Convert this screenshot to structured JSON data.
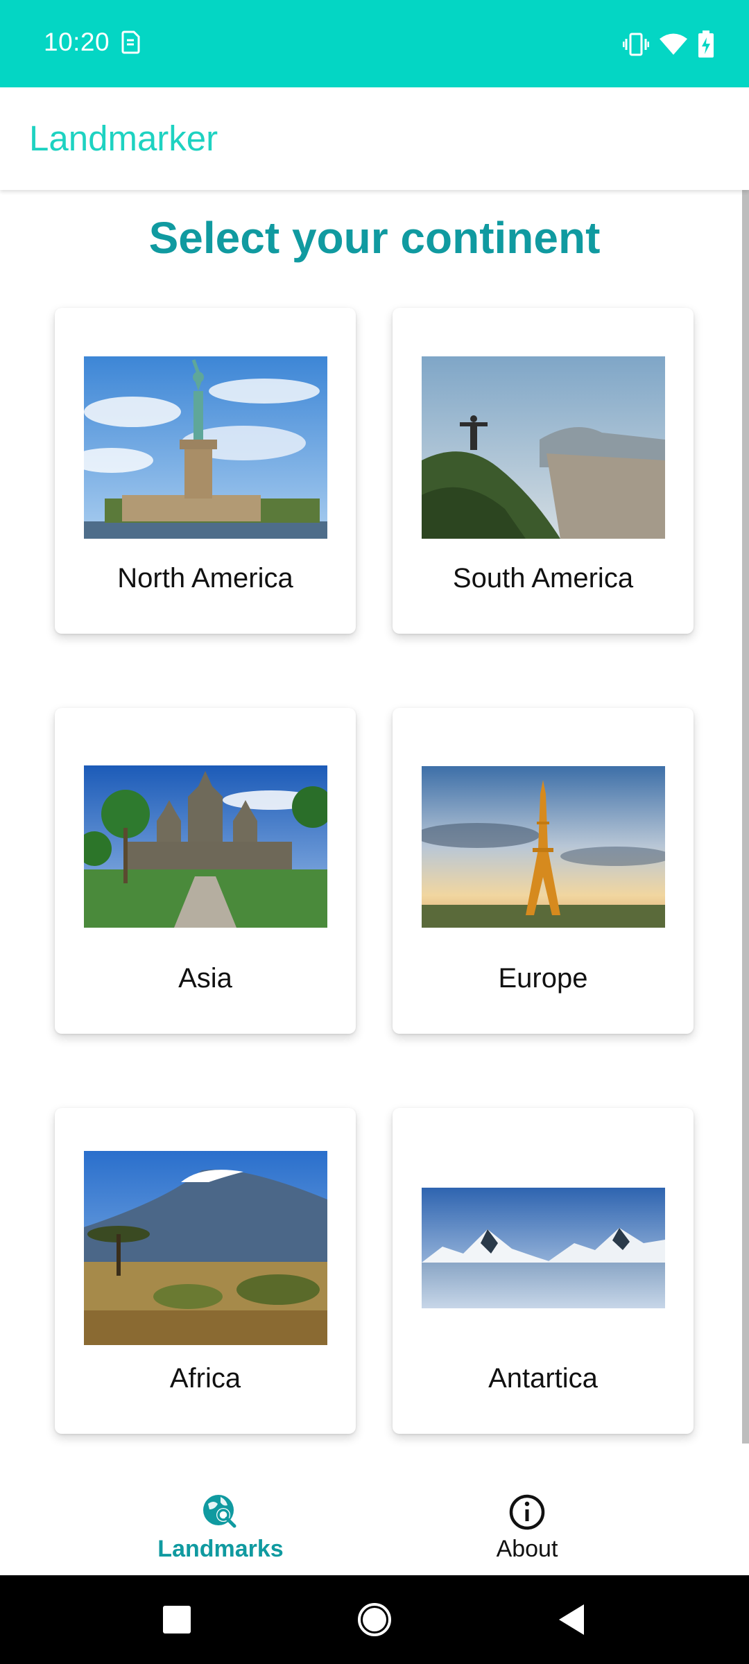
{
  "status_bar": {
    "time": "10:20",
    "background": "#04d6c4",
    "icons": [
      "sim-card-icon",
      "vibrate-icon",
      "wifi-icon",
      "battery-charging-icon"
    ]
  },
  "app_bar": {
    "title": "Landmarker",
    "title_color": "#1ed2c1"
  },
  "main": {
    "heading": "Select your continent",
    "heading_color": "#109aa0",
    "continents": [
      {
        "label": "North America",
        "image": "statue-of-liberty-photo"
      },
      {
        "label": "South America",
        "image": "christ-the-redeemer-photo"
      },
      {
        "label": "Asia",
        "image": "angkor-wat-photo"
      },
      {
        "label": "Europe",
        "image": "eiffel-tower-photo"
      },
      {
        "label": "Africa",
        "image": "kilimanjaro-photo"
      },
      {
        "label": "Antartica",
        "image": "antarctic-mountains-photo"
      }
    ]
  },
  "bottom_nav": {
    "items": [
      {
        "label": "Landmarks",
        "icon": "globe-search-icon",
        "active": true
      },
      {
        "label": "About",
        "icon": "info-icon",
        "active": false
      }
    ],
    "active_color": "#109aa0"
  },
  "system_nav": {
    "buttons": [
      "recents-button",
      "home-button",
      "back-button"
    ]
  }
}
